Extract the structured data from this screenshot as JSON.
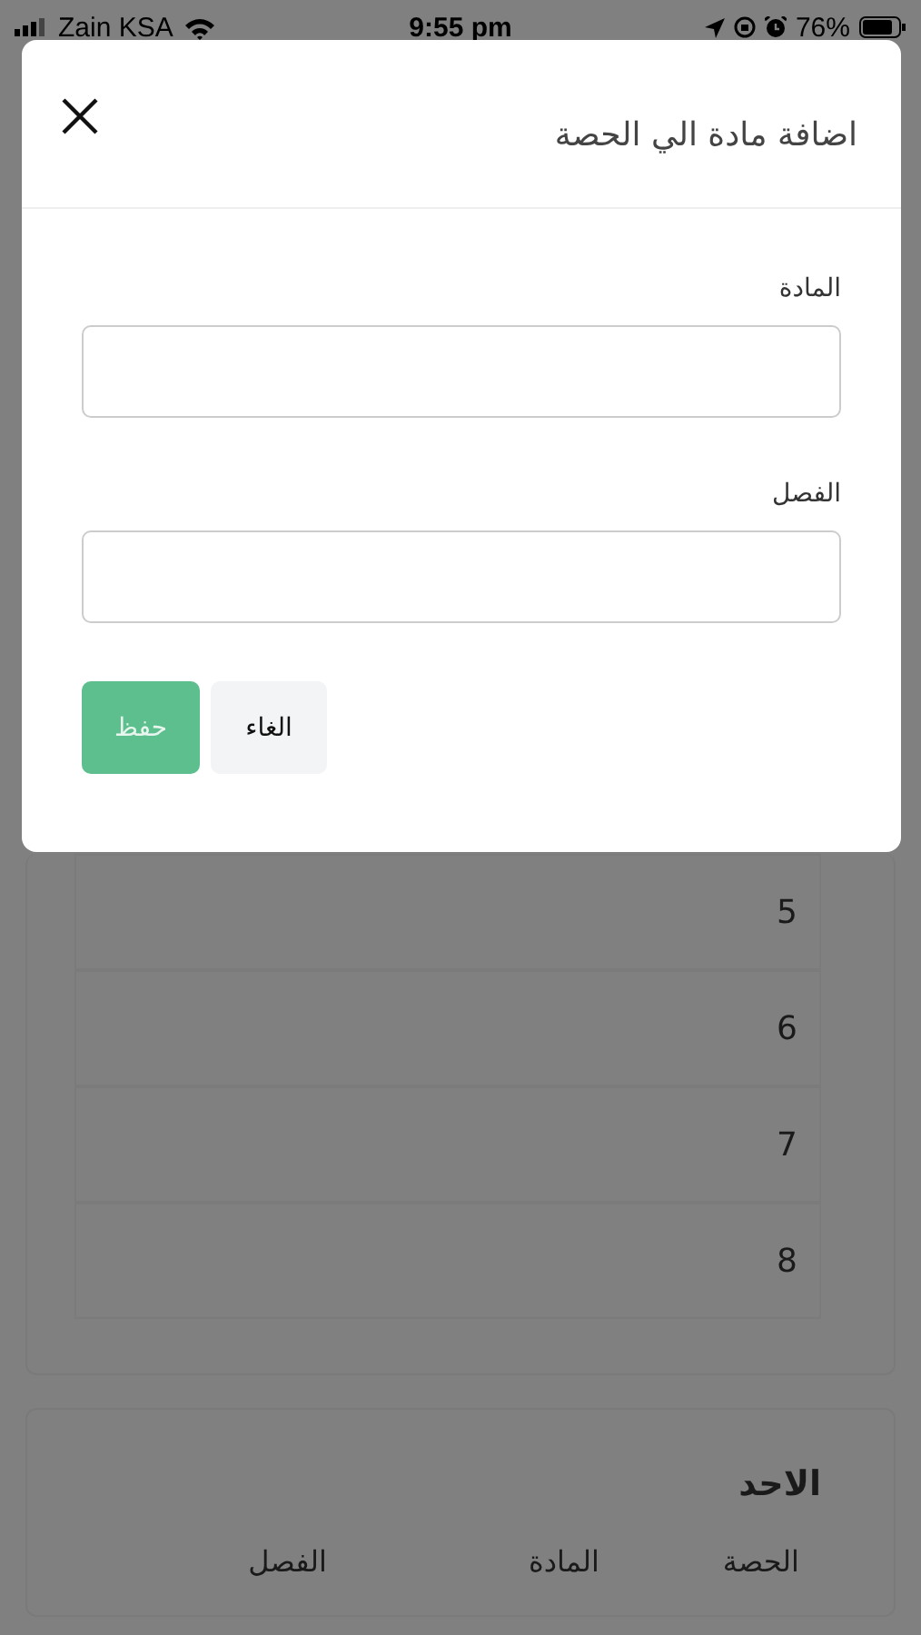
{
  "status_bar": {
    "carrier": "Zain KSA",
    "time": "9:55 pm",
    "battery": "76%"
  },
  "dialog": {
    "title": "اضافة مادة الي الحصة",
    "fields": [
      {
        "label": "المادة"
      },
      {
        "label": "الفصل"
      }
    ],
    "buttons": [
      {
        "label": "الغاء",
        "kind": "secondary"
      },
      {
        "label": "حفظ",
        "kind": "primary"
      }
    ]
  },
  "background": {
    "periods": [
      {
        "number": "5"
      },
      {
        "number": "6"
      },
      {
        "number": "7"
      },
      {
        "number": "8"
      }
    ],
    "day": {
      "title": "الاحد",
      "columns": [
        "الحصة",
        "المادة",
        "الفصل"
      ]
    }
  }
}
